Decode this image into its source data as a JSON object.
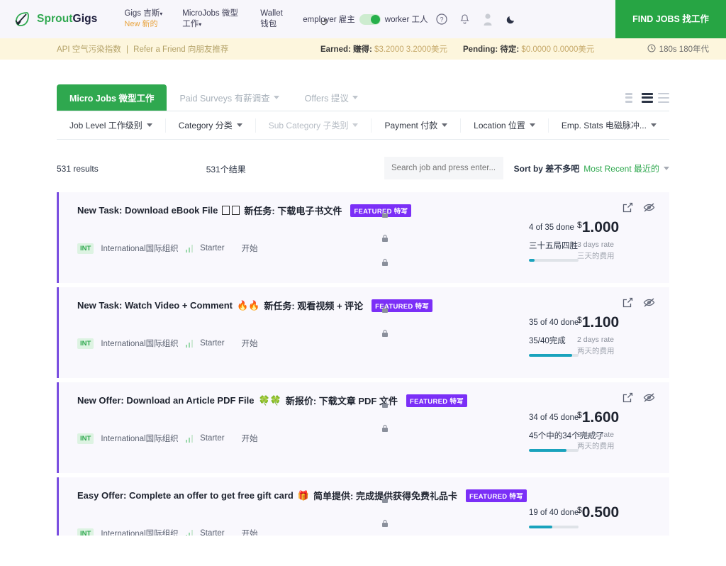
{
  "header": {
    "brand": {
      "part1": "Sprout",
      "part2": "Gigs",
      "icon": "leaf-check-logo"
    },
    "nav": [
      {
        "label": "Gigs 吉斯",
        "sub": "New 新的",
        "caret": true,
        "name": "gigs"
      },
      {
        "label": "MicroJobs 微型工作",
        "caret": true,
        "name": "microjobs"
      },
      {
        "label": "Wallet 钱包",
        "caret": false,
        "name": "wallet"
      }
    ],
    "role": {
      "employer": "employer 雇主",
      "worker": "worker 工人",
      "active": "worker"
    },
    "icons": [
      "help-icon",
      "bell-icon",
      "history-icon",
      "avatar-icon",
      "dark-mode-icon"
    ],
    "cta": "FIND JOBS 找工作"
  },
  "alertbar": {
    "api": "API 空气污染指数",
    "separator": "|",
    "refer": "Refer a Friend 向朋友推荐",
    "earned_label": "Earned: 赚得:",
    "earned_value": "$3.2000 3.2000美元",
    "pending_label": "Pending: 待定:",
    "pending_value": "$0.0000 0.0000美元",
    "timer": "180s 180年代"
  },
  "tabs": [
    {
      "label": "Micro Jobs 微型工作",
      "active": true,
      "caret": false
    },
    {
      "label": "Paid Surveys 有薪调查",
      "active": false,
      "caret": true
    },
    {
      "label": "Offers 提议",
      "active": false,
      "caret": true
    }
  ],
  "view_toggles": [
    {
      "name": "grid-view-icon",
      "active": false
    },
    {
      "name": "card-view-icon",
      "active": true
    },
    {
      "name": "list-view-icon",
      "active": false
    }
  ],
  "filters": [
    {
      "label": "Job Level 工作级别",
      "disabled": false
    },
    {
      "label": "Category 分类",
      "disabled": false
    },
    {
      "label": "Sub Category 子类别",
      "disabled": true
    },
    {
      "label": "Payment 付款",
      "disabled": false
    },
    {
      "label": "Location 位置",
      "disabled": false
    },
    {
      "label": "Emp. Stats 电磁脉冲...",
      "disabled": false
    }
  ],
  "results": {
    "count_en": "531 results",
    "count_cn": "531个结果",
    "search_placeholder": "Search job and press enter...",
    "search_value": "",
    "sort_label": "Sort by 差不多吧",
    "sort_value": "Most Recent 最近的"
  },
  "jobs": [
    {
      "title_en": "New Task: Download eBook File",
      "emoji": "□□",
      "emoji_kind": "box",
      "title_cn": "新任务: 下载电子书文件",
      "badge": "FEATURED 特写",
      "int_badge": "INT",
      "international": "International国际组织",
      "level_en": "Starter",
      "level_cn": "开始",
      "locks": 3,
      "progress_en": "4 of 35 done",
      "progress_done": "4",
      "progress_total": "35",
      "progress_cn": "三十五局四胜",
      "progress_pct": 11,
      "price": "1.000",
      "currency": "$",
      "rate_en": "3 days rate",
      "rate_cn": "三天的费用"
    },
    {
      "title_en": "New Task: Watch Video + Comment",
      "emoji": "🔥🔥",
      "emoji_kind": "emoji",
      "title_cn": "新任务: 观看视频 + 评论",
      "badge": "FEATURED 特写",
      "int_badge": "INT",
      "international": "International国际组织",
      "level_en": "Starter",
      "level_cn": "开始",
      "locks": 2,
      "progress_en": "35 of 40 done",
      "progress_done": "35",
      "progress_total": "40",
      "progress_cn": "35/40完成",
      "progress_pct": 87,
      "price": "1.100",
      "currency": "$",
      "rate_en": "2 days rate",
      "rate_cn": "两天的费用"
    },
    {
      "title_en": "New Offer: Download an Article PDF File",
      "emoji": "🍀🍀",
      "emoji_kind": "emoji",
      "title_cn": "新报价: 下载文章 PDF 文件",
      "badge": "FEATURED 特写",
      "int_badge": "INT",
      "international": "International国际组织",
      "level_en": "Starter",
      "level_cn": "开始",
      "locks": 2,
      "progress_en": "34 of 45 done",
      "progress_done": "34",
      "progress_total": "45",
      "progress_cn": "45个中的34个完成了",
      "progress_pct": 75,
      "price": "1.600",
      "currency": "$",
      "rate_en": "2 days rate",
      "rate_cn": "两天的费用"
    },
    {
      "title_en": "Easy Offer: Complete an offer to get free gift card",
      "emoji": "🎁",
      "emoji_kind": "emoji",
      "title_cn": "简单提供: 完成提供获得免费礼品卡",
      "badge": "FEATURED 特写",
      "int_badge": "INT",
      "international": "International国际组织",
      "level_en": "Starter",
      "level_cn": "开始",
      "locks": 2,
      "progress_en": "19 of 40 done",
      "progress_done": "19",
      "progress_total": "40",
      "progress_cn": "",
      "progress_pct": 47,
      "price": "0.500",
      "currency": "$",
      "rate_en": "",
      "rate_cn": ""
    }
  ],
  "colors": {
    "brand_green": "#2fa84f",
    "accent_purple": "#7b2ff7",
    "card_border": "#7a4fe0",
    "progress": "#1aa3bd",
    "alert_bg": "#fdf6dd"
  }
}
